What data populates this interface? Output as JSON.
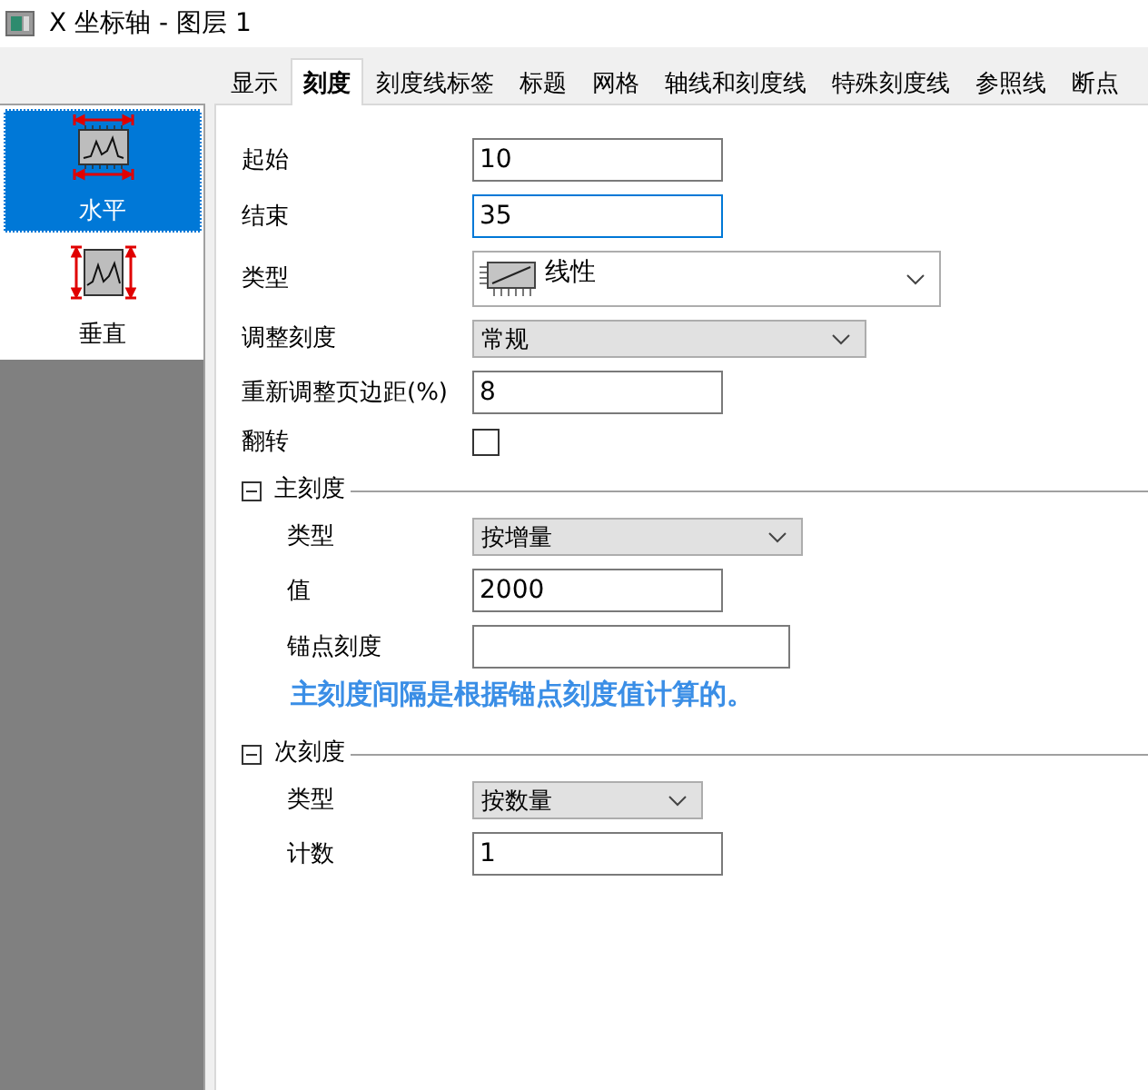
{
  "window": {
    "title": "X 坐标轴 - 图层 1"
  },
  "tabs": [
    {
      "label": "显示",
      "selected": false
    },
    {
      "label": "刻度",
      "selected": true
    },
    {
      "label": "刻度线标签",
      "selected": false
    },
    {
      "label": "标题",
      "selected": false
    },
    {
      "label": "网格",
      "selected": false
    },
    {
      "label": "轴线和刻度线",
      "selected": false
    },
    {
      "label": "特殊刻度线",
      "selected": false
    },
    {
      "label": "参照线",
      "selected": false
    },
    {
      "label": "断点",
      "selected": false
    }
  ],
  "sidebar": {
    "items": [
      {
        "label": "水平",
        "kind": "horizontal",
        "selected": true
      },
      {
        "label": "垂直",
        "kind": "vertical",
        "selected": false
      }
    ]
  },
  "fields": [
    {
      "kind": "text",
      "label": "起始",
      "value": "10",
      "focused": false
    },
    {
      "kind": "text",
      "label": "结束",
      "value": "35",
      "focused": true
    },
    {
      "kind": "combo",
      "label": "类型",
      "value": "线性"
    },
    {
      "kind": "dropdown",
      "label": "调整刻度",
      "value": "常规"
    },
    {
      "kind": "text",
      "label": "重新调整页边距(%)",
      "value": "8",
      "focused": false
    },
    {
      "kind": "checkbox",
      "label": "翻转",
      "checked": false
    }
  ],
  "sections": [
    {
      "title": "主刻度",
      "expanded": true,
      "fields": [
        {
          "kind": "dropdown",
          "label": "类型",
          "value": "按增量"
        },
        {
          "kind": "text",
          "label": "值",
          "value": "2000",
          "focused": false
        },
        {
          "kind": "text",
          "label": "锚点刻度",
          "focused": false
        }
      ],
      "note": "主刻度间隔是根据锚点刻度值计算的。"
    },
    {
      "title": "次刻度",
      "expanded": true,
      "fields": [
        {
          "kind": "dropdown",
          "label": "类型",
          "value": "按数量"
        },
        {
          "kind": "text",
          "label": "计数",
          "value": "1",
          "focused": false
        }
      ]
    }
  ]
}
